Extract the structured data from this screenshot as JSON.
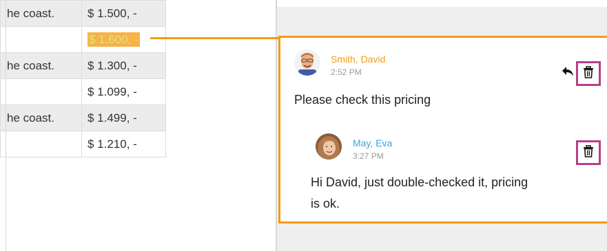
{
  "table": {
    "rows": [
      {
        "desc": "he coast.",
        "price": "$ 1.500, -",
        "highlighted": false
      },
      {
        "desc": "",
        "price": "$ 1.600, -",
        "highlighted": true
      },
      {
        "desc": "he coast.",
        "price": "$ 1.300, -",
        "highlighted": false
      },
      {
        "desc": "",
        "price": "$ 1.099, -",
        "highlighted": false
      },
      {
        "desc": "he coast.",
        "price": "$ 1.499, -",
        "highlighted": false
      },
      {
        "desc": "",
        "price": "$ 1.210, -",
        "highlighted": false
      }
    ]
  },
  "comments": {
    "main": {
      "author": "Smith, David",
      "time": "2:52 PM",
      "text": "Please check this pricing",
      "author_color": "#f39c12"
    },
    "reply": {
      "author": "May, Eva",
      "time": "3:27 PM",
      "text_line1": "Hi David, just double-checked it, pricing",
      "text_line2": "is ok.",
      "author_color": "#3aa3e3"
    }
  },
  "colors": {
    "accent": "#f39c12",
    "delete_highlight": "#b83e87"
  },
  "icons": {
    "trash": "trash-icon",
    "reply": "reply-arrow-icon"
  }
}
